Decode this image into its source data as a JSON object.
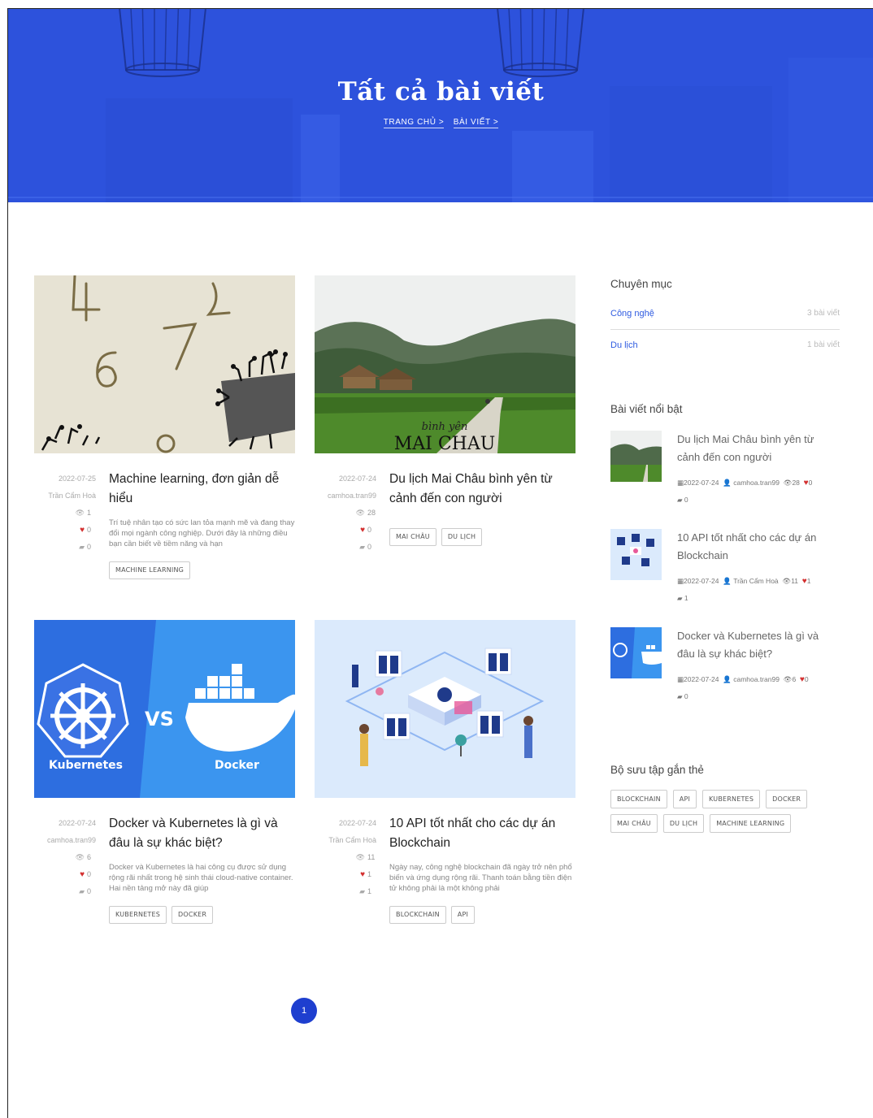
{
  "hero": {
    "title": "Tất cả bài viết",
    "breadcrumb": [
      "TRANG CHỦ >",
      "BÀI VIẾT >"
    ]
  },
  "posts": [
    {
      "date": "2022-07-25",
      "author": "Trần Cẩm Hoà",
      "views": "1",
      "likes": "0",
      "comments": "0",
      "title": "Machine learning, đơn giản dễ hiểu",
      "excerpt": "Trí tuệ nhân tạo có sức lan tỏa mạnh mẽ và đang thay đổi mọi ngành công nghiệp. Dưới đây là những điều bạn cần biết về tiềm năng và hạn",
      "tags": [
        "MACHINE LEARNING"
      ],
      "image": "numbers-circuit-image"
    },
    {
      "date": "2022-07-24",
      "author": "camhoa.tran99",
      "views": "28",
      "likes": "0",
      "comments": "0",
      "title": "Du lịch Mai Châu bình yên từ cảnh đến con người",
      "excerpt": "",
      "tags": [
        "MAI CHÂU",
        "DU LỊCH"
      ],
      "image": "mai-chau-landscape-image",
      "image_text": "MAI CHAU"
    },
    {
      "date": "2022-07-24",
      "author": "camhoa.tran99",
      "views": "6",
      "likes": "0",
      "comments": "0",
      "title": "Docker và Kubernetes là gì và đâu là sự khác biệt?",
      "excerpt": "Docker và Kubernetes là hai công cụ được sử dụng rộng rãi nhất trong hệ sinh thái cloud-native container. Hai nền tảng mở này đã giúp",
      "tags": [
        "KUBERNETES",
        "DOCKER"
      ],
      "image": "kubernetes-vs-docker-image",
      "image_labels": [
        "Kubernetes",
        "VS",
        "Docker"
      ]
    },
    {
      "date": "2022-07-24",
      "author": "Trần Cẩm Hoà",
      "views": "11",
      "likes": "1",
      "comments": "1",
      "title": "10 API tốt nhất cho các dự án Blockchain",
      "excerpt": "Ngày nay, công nghệ blockchain đã ngày trở nên phổ biến và ứng dụng rộng rãi. Thanh toán bằng tiền điện tử không phải là một không phải",
      "tags": [
        "BLOCKCHAIN",
        "API"
      ],
      "image": "blockchain-isometric-image"
    }
  ],
  "sidebar": {
    "categories_title": "Chuyên mục",
    "categories": [
      {
        "name": "Công nghệ",
        "count": "3 bài viết"
      },
      {
        "name": "Du lịch",
        "count": "1 bài viết"
      }
    ],
    "featured_title": "Bài viết nổi bật",
    "featured": [
      {
        "title": "Du lịch Mai Châu bình yên từ cảnh đến con người",
        "date": "2022-07-24",
        "author": "camhoa.tran99",
        "views": "28",
        "likes": "0",
        "comments": "0"
      },
      {
        "title": "10 API tốt nhất cho các dự án Blockchain",
        "date": "2022-07-24",
        "author": "Trần Cẩm Hoà",
        "views": "11",
        "likes": "1",
        "comments": "1"
      },
      {
        "title": "Docker và Kubernetes là gì và đâu là sự khác biệt?",
        "date": "2022-07-24",
        "author": "camhoa.tran99",
        "views": "6",
        "likes": "0",
        "comments": "0"
      }
    ],
    "tags_title": "Bộ sưu tập gắn thẻ",
    "tags": [
      "BLOCKCHAIN",
      "API",
      "KUBERNETES",
      "DOCKER",
      "MAI CHÂU",
      "DU LỊCH",
      "MACHINE LEARNING"
    ]
  },
  "pagination": {
    "current": "1"
  },
  "colors": {
    "accent": "#2f5be0",
    "hero": "#2f55e0",
    "heart": "#d32f2f"
  }
}
